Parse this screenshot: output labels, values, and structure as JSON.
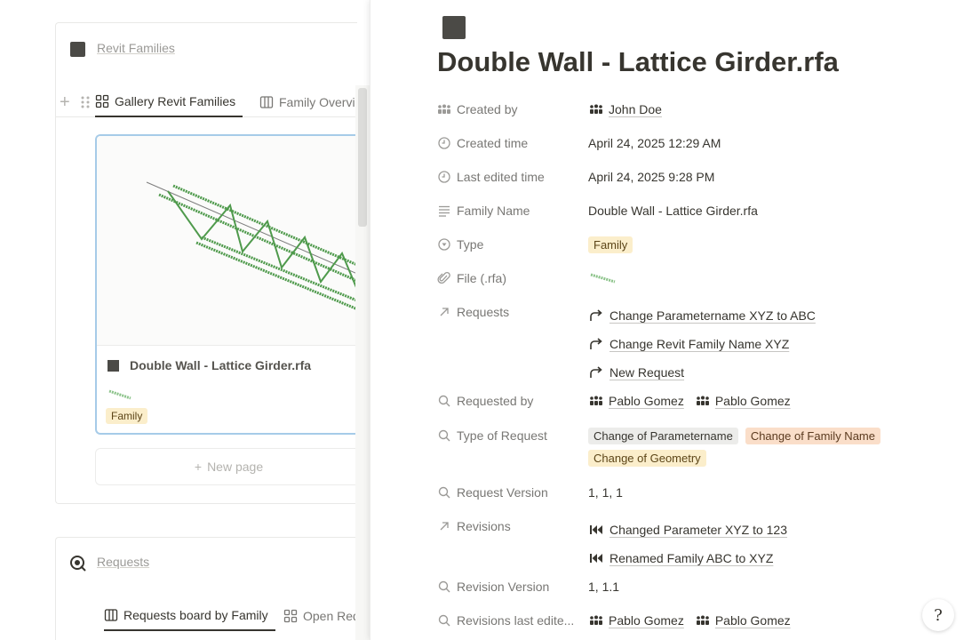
{
  "left": {
    "db1": {
      "title": "Revit Families",
      "tabs": [
        "Gallery Revit Families",
        "Family Overvi"
      ],
      "card": {
        "title": "Double Wall - Lattice Girder.rfa",
        "tag": "Family"
      },
      "new_page": "New page"
    },
    "db2": {
      "title": "Requests",
      "tabs": [
        "Requests board by Family",
        "Open Req"
      ]
    }
  },
  "page": {
    "title": "Double Wall - Lattice Girder.rfa",
    "properties": {
      "created_by": {
        "name": "Created by",
        "value": "John Doe"
      },
      "created_time": {
        "name": "Created time",
        "value": "April 24, 2025 12:29 AM"
      },
      "last_edited_time": {
        "name": "Last edited time",
        "value": "April 24, 2025 9:28 PM"
      },
      "family_name": {
        "name": "Family Name",
        "value": "Double Wall - Lattice Girder.rfa"
      },
      "type": {
        "name": "Type",
        "value": "Family"
      },
      "file": {
        "name": "File (.rfa)"
      },
      "requests": {
        "name": "Requests",
        "items": [
          "Change Parametername XYZ to ABC",
          "Change Revit Family Name XYZ",
          "New Request"
        ]
      },
      "requested_by": {
        "name": "Requested by",
        "people": [
          "Pablo Gomez",
          "Pablo Gomez"
        ]
      },
      "type_of_request": {
        "name": "Type of Request",
        "tags": [
          "Change of Parametername",
          "Change of Family Name",
          "Change of Geometry"
        ]
      },
      "request_version": {
        "name": "Request Version",
        "value": "1, 1, 1"
      },
      "revisions": {
        "name": "Revisions",
        "items": [
          "Changed Parameter XYZ to 123",
          "Renamed Family ABC to XYZ"
        ]
      },
      "revision_version": {
        "name": "Revision Version",
        "value": "1, 1.1"
      },
      "revisions_last_edited": {
        "name": "Revisions last edite...",
        "people": [
          "Pablo Gomez",
          "Pablo Gomez"
        ]
      }
    }
  },
  "help_label": "?",
  "colors": {
    "tag_yellow": "#fbeecb",
    "tag_gray": "#ececea",
    "tag_orange": "#fadec9",
    "accent_card_border": "#a6cbe8",
    "girder_green": "#4f9a4c"
  }
}
